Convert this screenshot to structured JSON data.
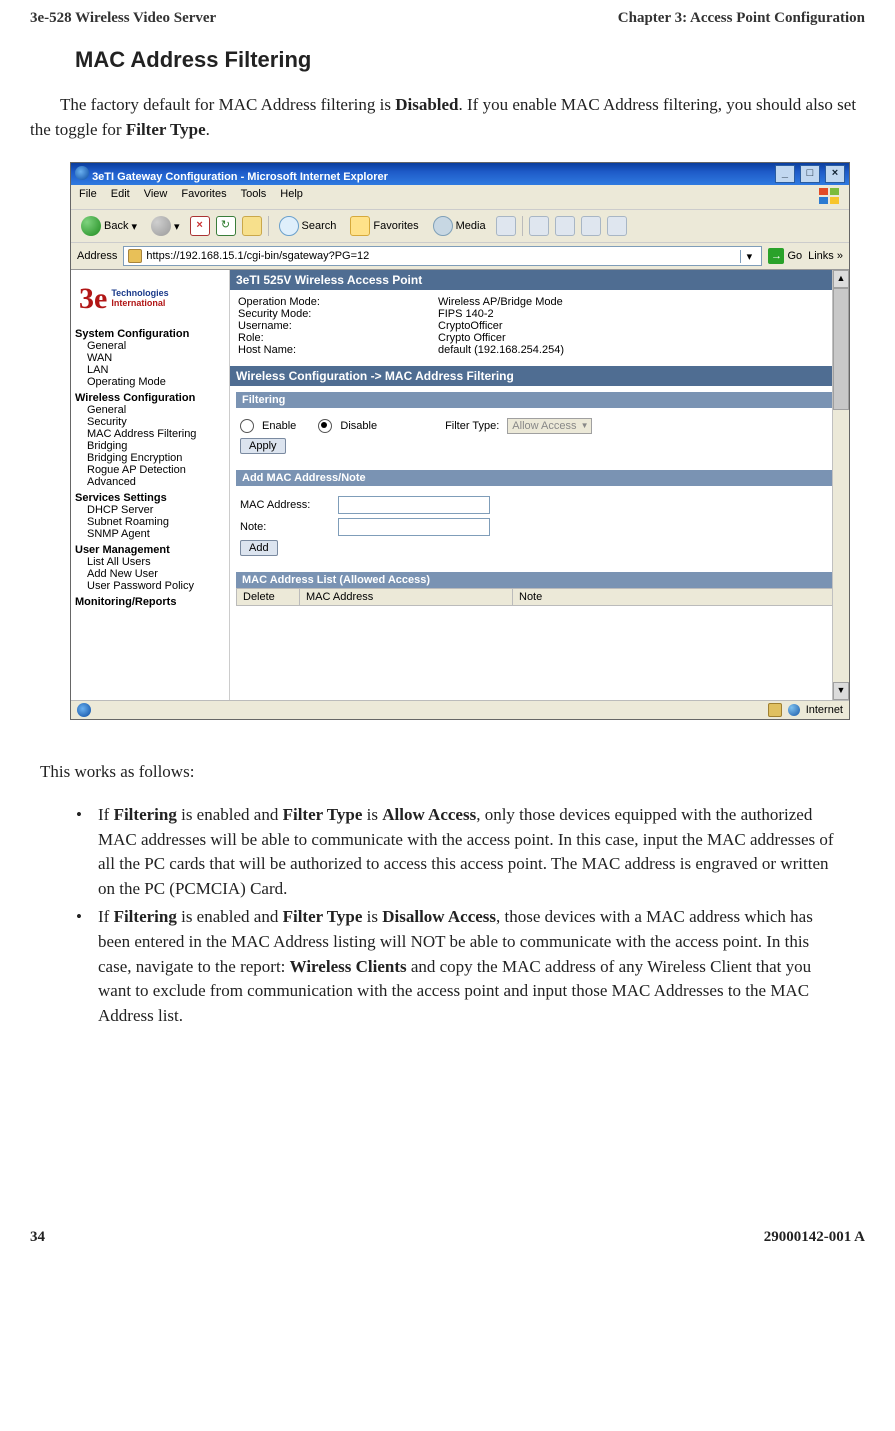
{
  "header": {
    "left": "3e-528 Wireless Video Server",
    "right": "Chapter 3: Access Point Configuration"
  },
  "headings": {
    "mac_filtering": "MAC Address Filtering"
  },
  "intro": {
    "part1": "The factory default for MAC Address filtering is ",
    "disabled": "Disabled",
    "part2": ". If you enable MAC Address filtering, you should also set the toggle for ",
    "filter_type": "Filter Type",
    "part3": "."
  },
  "ie": {
    "title": "3eTI Gateway Configuration - Microsoft Internet Explorer",
    "menu": {
      "file": "File",
      "edit": "Edit",
      "view": "View",
      "favorites": "Favorites",
      "tools": "Tools",
      "help": "Help"
    },
    "toolbar": {
      "back": "Back",
      "search": "Search",
      "favorites": "Favorites",
      "media": "Media"
    },
    "address_label": "Address",
    "url": "https://192.168.15.1/cgi-bin/sgateway?PG=12",
    "go": "Go",
    "links": "Links",
    "status_zone": "Internet"
  },
  "logo": {
    "tech": "Technologies",
    "intl": "International"
  },
  "nav": {
    "g1": "System Configuration",
    "g1_items": [
      "General",
      "WAN",
      "LAN",
      "Operating Mode"
    ],
    "g2": "Wireless Configuration",
    "g2_items": [
      "General",
      "Security",
      "MAC Address Filtering",
      "Bridging",
      "Bridging Encryption",
      "Rogue AP Detection",
      "Advanced"
    ],
    "g3": "Services Settings",
    "g3_items": [
      "DHCP Server",
      "Subnet Roaming",
      "SNMP Agent"
    ],
    "g4": "User Management",
    "g4_items": [
      "List All Users",
      "Add New User",
      "User Password Policy"
    ],
    "g5": "Monitoring/Reports"
  },
  "panel": {
    "title": "3eTI 525V Wireless Access Point",
    "rows": {
      "op_mode_l": "Operation Mode:",
      "op_mode_v": "Wireless AP/Bridge Mode",
      "sec_mode_l": "Security Mode:",
      "sec_mode_v": "FIPS 140-2",
      "user_l": "Username:",
      "user_v": "CryptoOfficer",
      "role_l": "Role:",
      "role_v": "Crypto Officer",
      "host_l": "Host Name:",
      "host_v": "default (192.168.254.254)"
    },
    "section": "Wireless Configuration -> MAC Address Filtering",
    "filtering_head": "Filtering",
    "enable": "Enable",
    "disable": "Disable",
    "filter_type_label": "Filter Type:",
    "filter_type_value": "Allow Access",
    "apply": "Apply",
    "add_head": "Add MAC Address/Note",
    "mac_label": "MAC Address:",
    "note_label": "Note:",
    "add_btn": "Add",
    "list_head": "MAC Address List (Allowed Access)",
    "th_delete": "Delete",
    "th_mac": "MAC Address",
    "th_note": "Note"
  },
  "works": "This works as follows:",
  "bullet1": {
    "p1": "If ",
    "b1": "Filtering",
    "p2": " is enabled and ",
    "b2": "Filter Type",
    "p3": " is ",
    "b3": "Allow Access",
    "p4": ", only those devices equipped with the authorized MAC addresses will be able to communicate with the access point. In this case, input the MAC addresses of all the PC cards that will be authorized to access this access point. The MAC address is engraved or written on the PC (PCMCIA) Card."
  },
  "bullet2": {
    "p1": "If ",
    "b1": "Filtering",
    "p2": " is enabled and ",
    "b2": "Filter Type",
    "p3": " is ",
    "b3": "Disallow Access",
    "p4": ", those devices with a MAC address which has been entered in the MAC Address listing will NOT be able to communicate with the access point. In this case, navigate to the report: ",
    "b4": "Wireless Clients",
    "p5": " and copy the MAC address of any Wireless Client that you want to exclude from communication with the access point and input those MAC Addresses to the MAC Address list."
  },
  "footer": {
    "left": "34",
    "right": "29000142-001 A"
  }
}
